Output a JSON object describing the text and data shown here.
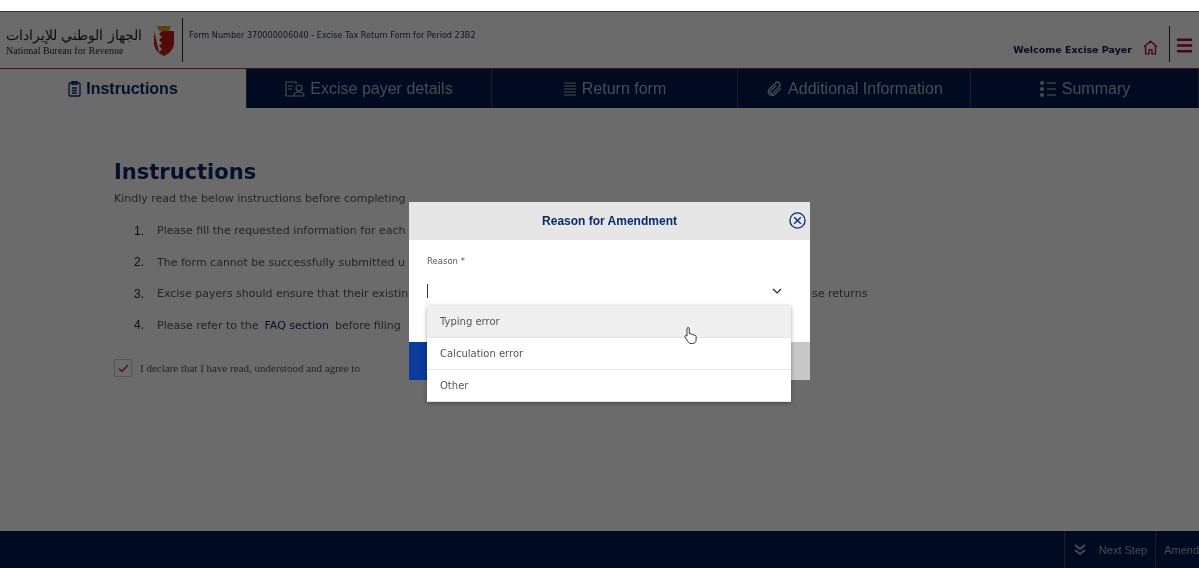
{
  "header": {
    "logo_arabic": "الجهاز الوطني للإيرادات",
    "logo_english": "National Bureau for Revenue",
    "form_title": "Form Number 370000006040 - Excise Tax Return Form for Period 23B2",
    "welcome": "Welcome Excise Payer"
  },
  "tabs": [
    {
      "label": "Instructions",
      "selected": true
    },
    {
      "label": "Excise payer details",
      "selected": false
    },
    {
      "label": "Return form",
      "selected": false
    },
    {
      "label": "Additional Information",
      "selected": false
    },
    {
      "label": "Summary",
      "selected": false
    }
  ],
  "instructions": {
    "title": "Instructions",
    "intro": "Kindly read the below instructions before completing",
    "items": [
      {
        "number": "1.",
        "text": "Please fill the requested information for each"
      },
      {
        "number": "2.",
        "text": "The form cannot be successfully submitted u"
      },
      {
        "number": "3.",
        "text": "Excise payers should ensure that their existin",
        "tail": "se returns"
      },
      {
        "number": "4.",
        "text": "Please refer to the",
        "link": "FAQ section",
        "after": "before filing"
      }
    ],
    "declaration": {
      "checked": true,
      "text": "I declare that I have read, understood and agree to"
    }
  },
  "modal": {
    "title": "Reason for Amendment",
    "field_label": "Reason *",
    "options": [
      {
        "label": "Typing error",
        "selected": true
      },
      {
        "label": "Calculation error",
        "selected": false
      },
      {
        "label": "Other",
        "selected": false
      }
    ]
  },
  "footer": {
    "buttons": [
      {
        "label": "Next Step"
      },
      {
        "label": "Amend"
      }
    ]
  }
}
